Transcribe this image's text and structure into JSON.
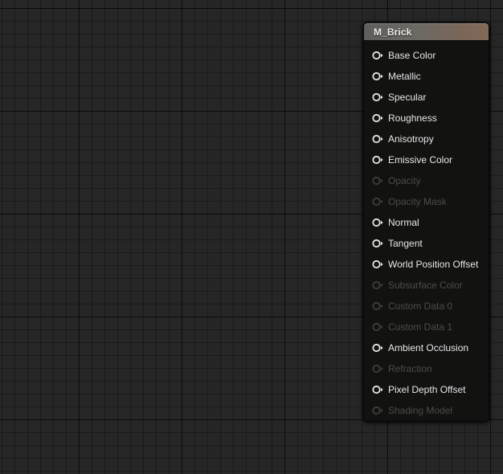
{
  "node": {
    "title": "M_Brick",
    "pins": [
      {
        "label": "Base Color",
        "enabled": true
      },
      {
        "label": "Metallic",
        "enabled": true
      },
      {
        "label": "Specular",
        "enabled": true
      },
      {
        "label": "Roughness",
        "enabled": true
      },
      {
        "label": "Anisotropy",
        "enabled": true
      },
      {
        "label": "Emissive Color",
        "enabled": true
      },
      {
        "label": "Opacity",
        "enabled": false
      },
      {
        "label": "Opacity Mask",
        "enabled": false
      },
      {
        "label": "Normal",
        "enabled": true
      },
      {
        "label": "Tangent",
        "enabled": true
      },
      {
        "label": "World Position Offset",
        "enabled": true
      },
      {
        "label": "Subsurface Color",
        "enabled": false
      },
      {
        "label": "Custom Data 0",
        "enabled": false
      },
      {
        "label": "Custom Data 1",
        "enabled": false
      },
      {
        "label": "Ambient Occlusion",
        "enabled": true
      },
      {
        "label": "Refraction",
        "enabled": false
      },
      {
        "label": "Pixel Depth Offset",
        "enabled": true
      },
      {
        "label": "Shading Model",
        "enabled": false
      }
    ]
  },
  "icons": {
    "pin": "input-pin-icon"
  },
  "colors": {
    "canvas": "#262626",
    "node_body": "#121311",
    "pin_active": "#e6e6e6",
    "pin_inactive": "#4b4b4b"
  }
}
